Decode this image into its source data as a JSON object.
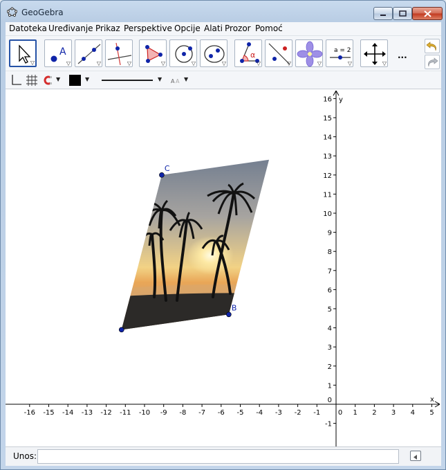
{
  "window": {
    "title": "GeoGebra"
  },
  "menu": [
    "Datoteka",
    "Uređivanje",
    "Prikaz",
    "Perspektive",
    "Opcije",
    "Alati",
    "Prozor",
    "Pomoć"
  ],
  "toolbar": {
    "tools": [
      "move",
      "point",
      "line",
      "perpendicular-line",
      "polygon",
      "circle",
      "conic",
      "angle",
      "reflect",
      "slider-flower",
      "slider",
      "move-view"
    ],
    "slider_label": "a = 2",
    "angle_label": "α",
    "point_label": "A",
    "more": "..."
  },
  "input": {
    "label": "Unos:",
    "value": ""
  },
  "graphics": {
    "x_axis_label": "x",
    "y_axis_label": "y",
    "x_ticks": [
      "-16",
      "-15",
      "-14",
      "-13",
      "-12",
      "-11",
      "-10",
      "-9",
      "-8",
      "-7",
      "-6",
      "-5",
      "-4",
      "-3",
      "-2",
      "-1",
      "0",
      "1",
      "2",
      "3",
      "4",
      "5"
    ],
    "y_ticks": [
      "-1",
      "0",
      "1",
      "2",
      "3",
      "4",
      "5",
      "6",
      "7",
      "8",
      "9",
      "10",
      "11",
      "12",
      "13",
      "14",
      "15",
      "16"
    ],
    "points": [
      {
        "name": "A",
        "x": -11.2,
        "y": 3.9,
        "show_label": false
      },
      {
        "name": "B",
        "x": -5.6,
        "y": 4.7,
        "show_label": true
      },
      {
        "name": "C",
        "x": -9.1,
        "y": 12.0,
        "show_label": true
      }
    ],
    "image_fourth_corner": {
      "x": -3.5,
      "y": 12.8
    },
    "point_color": "#0f24a8",
    "label_color": "#0f24a8"
  }
}
